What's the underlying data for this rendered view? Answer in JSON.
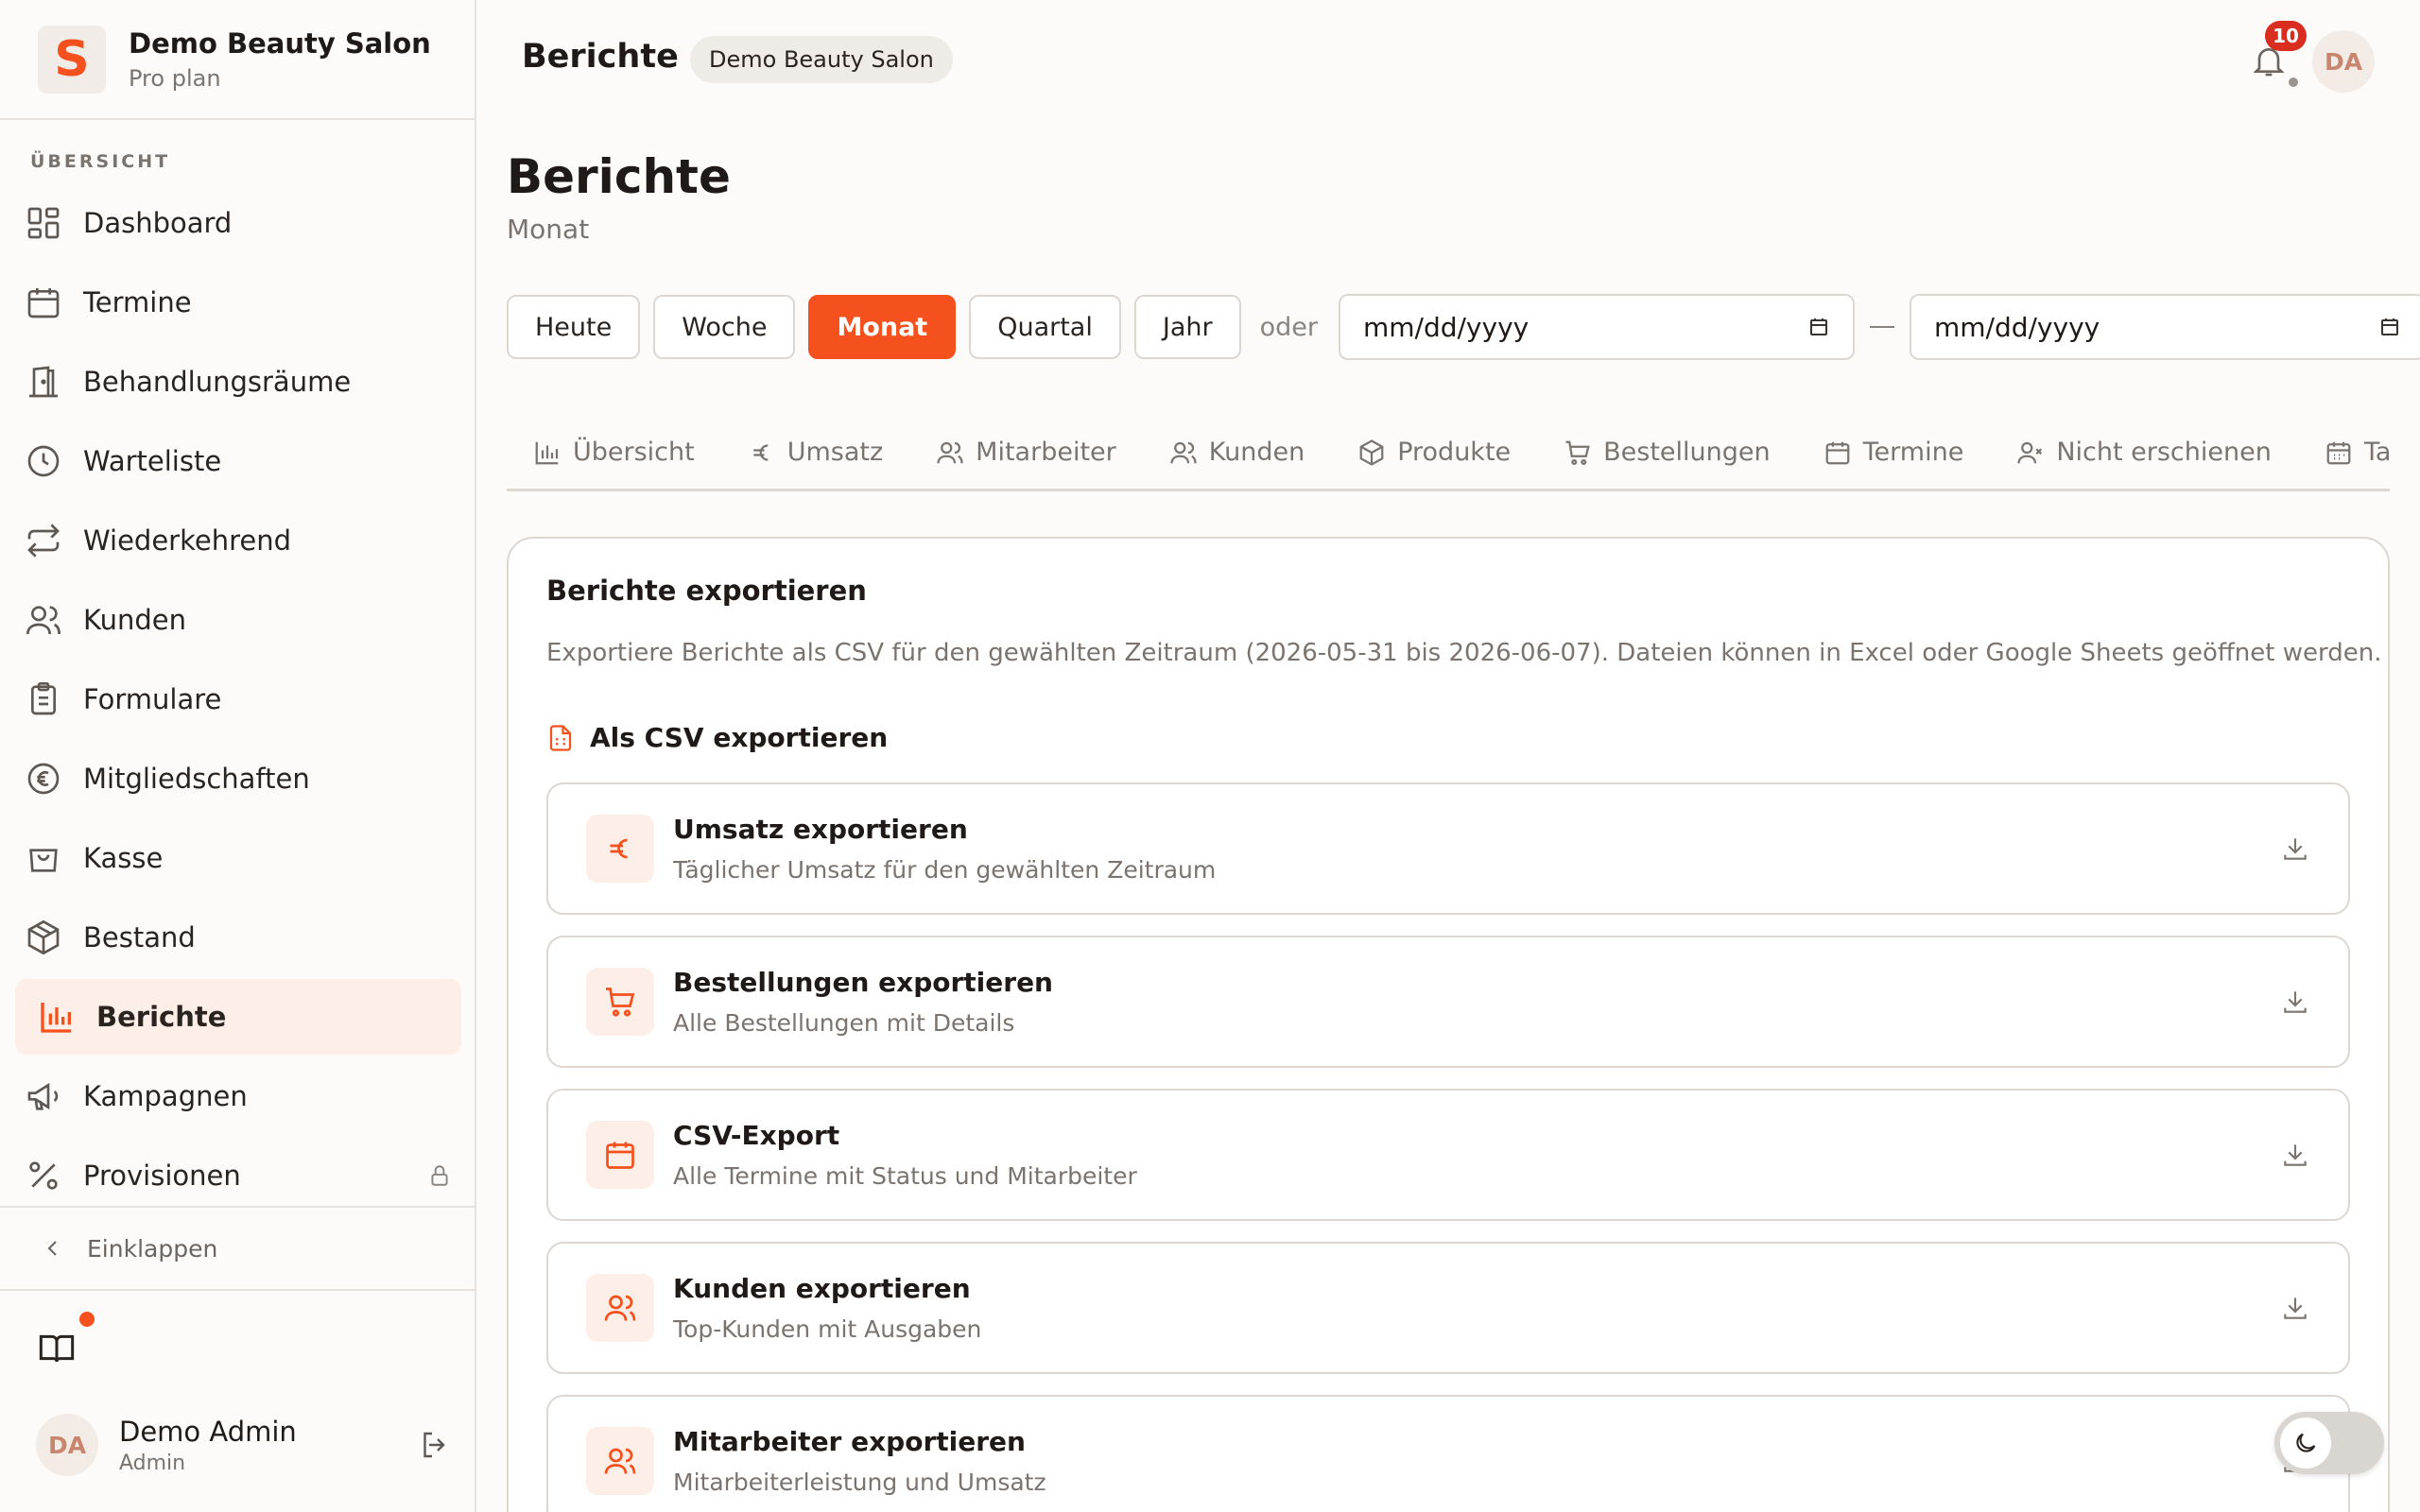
{
  "brand": {
    "name": "Demo Beauty Salon",
    "plan": "Pro plan",
    "logo_letter": "S",
    "accent": "#f4511e"
  },
  "sidebar": {
    "section_label": "ÜBERSICHT",
    "items": [
      {
        "label": "Dashboard",
        "icon": "dashboard-icon"
      },
      {
        "label": "Termine",
        "icon": "calendar-icon"
      },
      {
        "label": "Behandlungsräume",
        "icon": "door-icon"
      },
      {
        "label": "Warteliste",
        "icon": "clock-icon"
      },
      {
        "label": "Wiederkehrend",
        "icon": "repeat-icon"
      },
      {
        "label": "Kunden",
        "icon": "users-icon"
      },
      {
        "label": "Formulare",
        "icon": "clipboard-icon"
      },
      {
        "label": "Mitgliedschaften",
        "icon": "euro-circle-icon"
      },
      {
        "label": "Kasse",
        "icon": "shopping-bag-icon"
      },
      {
        "label": "Bestand",
        "icon": "package-icon"
      },
      {
        "label": "Berichte",
        "icon": "bar-chart-icon",
        "active": true
      },
      {
        "label": "Kampagnen",
        "icon": "megaphone-icon"
      },
      {
        "label": "Provisionen",
        "icon": "percent-icon",
        "locked": true
      }
    ],
    "collapse_label": "Einklappen"
  },
  "user": {
    "initials": "DA",
    "name": "Demo Admin",
    "role": "Admin"
  },
  "topbar": {
    "title": "Berichte",
    "chip": "Demo Beauty Salon",
    "notification_count": "10",
    "avatar_initials": "DA"
  },
  "page": {
    "heading": "Berichte",
    "subtitle": "Monat"
  },
  "periods": {
    "buttons": [
      {
        "label": "Heute"
      },
      {
        "label": "Woche"
      },
      {
        "label": "Monat",
        "active": true
      },
      {
        "label": "Quartal"
      },
      {
        "label": "Jahr"
      }
    ],
    "or_label": "oder",
    "date_from_placeholder": "mm/dd/yyyy",
    "date_to_placeholder": "mm/dd/yyyy"
  },
  "tabs": [
    {
      "label": "Übersicht",
      "icon": "bar-chart-icon"
    },
    {
      "label": "Umsatz",
      "icon": "euro-icon"
    },
    {
      "label": "Mitarbeiter",
      "icon": "users-icon"
    },
    {
      "label": "Kunden",
      "icon": "users-icon"
    },
    {
      "label": "Produkte",
      "icon": "package-icon"
    },
    {
      "label": "Bestellungen",
      "icon": "cart-icon"
    },
    {
      "label": "Termine",
      "icon": "calendar-icon"
    },
    {
      "label": "Nicht erschienen",
      "icon": "user-x-icon"
    },
    {
      "label": "Tagesl",
      "icon": "calendar-grid-icon"
    }
  ],
  "export": {
    "title": "Berichte exportieren",
    "description": "Exportiere Berichte als CSV für den gewählten Zeitraum (2026-05-31 bis 2026-06-07). Dateien können in Excel oder Google Sheets geöffnet werden.",
    "csv_heading": "Als CSV exportieren",
    "rows": [
      {
        "title": "Umsatz exportieren",
        "subtitle": "Täglicher Umsatz für den gewählten Zeitraum",
        "icon": "euro-icon"
      },
      {
        "title": "Bestellungen exportieren",
        "subtitle": "Alle Bestellungen mit Details",
        "icon": "cart-icon"
      },
      {
        "title": "CSV-Export",
        "subtitle": "Alle Termine mit Status und Mitarbeiter",
        "icon": "calendar-icon"
      },
      {
        "title": "Kunden exportieren",
        "subtitle": "Top-Kunden mit Ausgaben",
        "icon": "users-icon"
      },
      {
        "title": "Mitarbeiter exportieren",
        "subtitle": "Mitarbeiterleistung und Umsatz",
        "icon": "users-icon"
      }
    ]
  }
}
